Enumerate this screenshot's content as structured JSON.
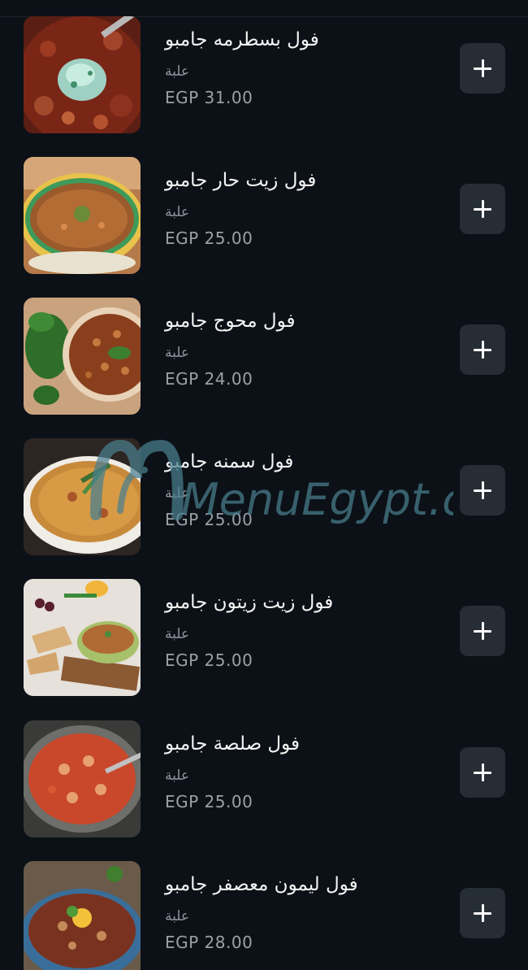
{
  "currency": "EGP",
  "items": [
    {
      "name": "فول بسطرمه جامبو",
      "unit": "علبة",
      "price": "EGP 31.00",
      "add_label": "+",
      "image": "stew-with-herbs-image"
    },
    {
      "name": "فول زيت حار جامبو",
      "unit": "علبة",
      "price": "EGP 25.00",
      "add_label": "+",
      "image": "bowl-of-foul-image"
    },
    {
      "name": "فول محوج جامبو",
      "unit": "علبة",
      "price": "EGP 24.00",
      "add_label": "+",
      "image": "beans-with-spinach-image"
    },
    {
      "name": "فول سمنه جامبو",
      "unit": "علبة",
      "price": "EGP 25.00",
      "add_label": "+",
      "image": "soup-bowl-image"
    },
    {
      "name": "فول زيت زيتون جامبو",
      "unit": "علبة",
      "price": "EGP 25.00",
      "add_label": "+",
      "image": "foul-with-bread-image"
    },
    {
      "name": "فول صلصة جامبو",
      "unit": "علبة",
      "price": "EGP 25.00",
      "add_label": "+",
      "image": "tomato-beans-image"
    },
    {
      "name": "فول ليمون معصفر جامبو",
      "unit": "علبة",
      "price": "EGP 28.00",
      "add_label": "+",
      "image": "beans-with-lemon-image"
    }
  ],
  "watermark": "MenuEgypt.com",
  "colors": {
    "background": "#0c1117",
    "button_bg": "#262d35",
    "muted_text": "#8f959c",
    "watermark": "#4a7f8f"
  }
}
